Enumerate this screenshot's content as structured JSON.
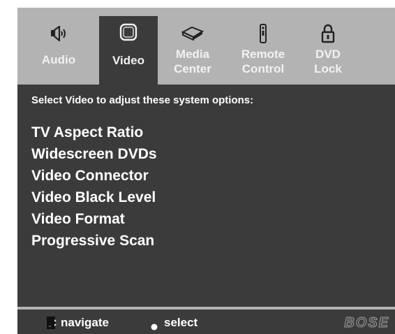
{
  "tabs": [
    {
      "id": "audio",
      "label": "Audio",
      "icon": "speaker-icon",
      "active": false
    },
    {
      "id": "video",
      "label": "Video",
      "icon": "tv-icon",
      "active": true
    },
    {
      "id": "media",
      "label_line1": "Media",
      "label_line2": "Center",
      "icon": "media-center-icon",
      "active": false
    },
    {
      "id": "remote",
      "label_line1": "Remote",
      "label_line2": "Control",
      "icon": "remote-icon",
      "active": false
    },
    {
      "id": "dvd",
      "label_line1": "DVD",
      "label_line2": "Lock",
      "icon": "lock-icon",
      "active": false
    }
  ],
  "panel": {
    "prompt": "Select Video to adjust these system options:",
    "options": [
      "TV Aspect Ratio",
      "Widescreen DVDs",
      "Video Connector",
      "Video Black Level",
      "Video Format",
      "Progressive Scan"
    ]
  },
  "footer": {
    "navigate_label": "navigate",
    "select_label": "select",
    "navigate_icon": "navigation-pad-icon",
    "select_icon": "select-dot-icon",
    "logo": "BOSE"
  },
  "colors": {
    "panel_bg": "#3b3b3b",
    "tab_bg": "#b3b3b3",
    "text": "#ffffff"
  }
}
